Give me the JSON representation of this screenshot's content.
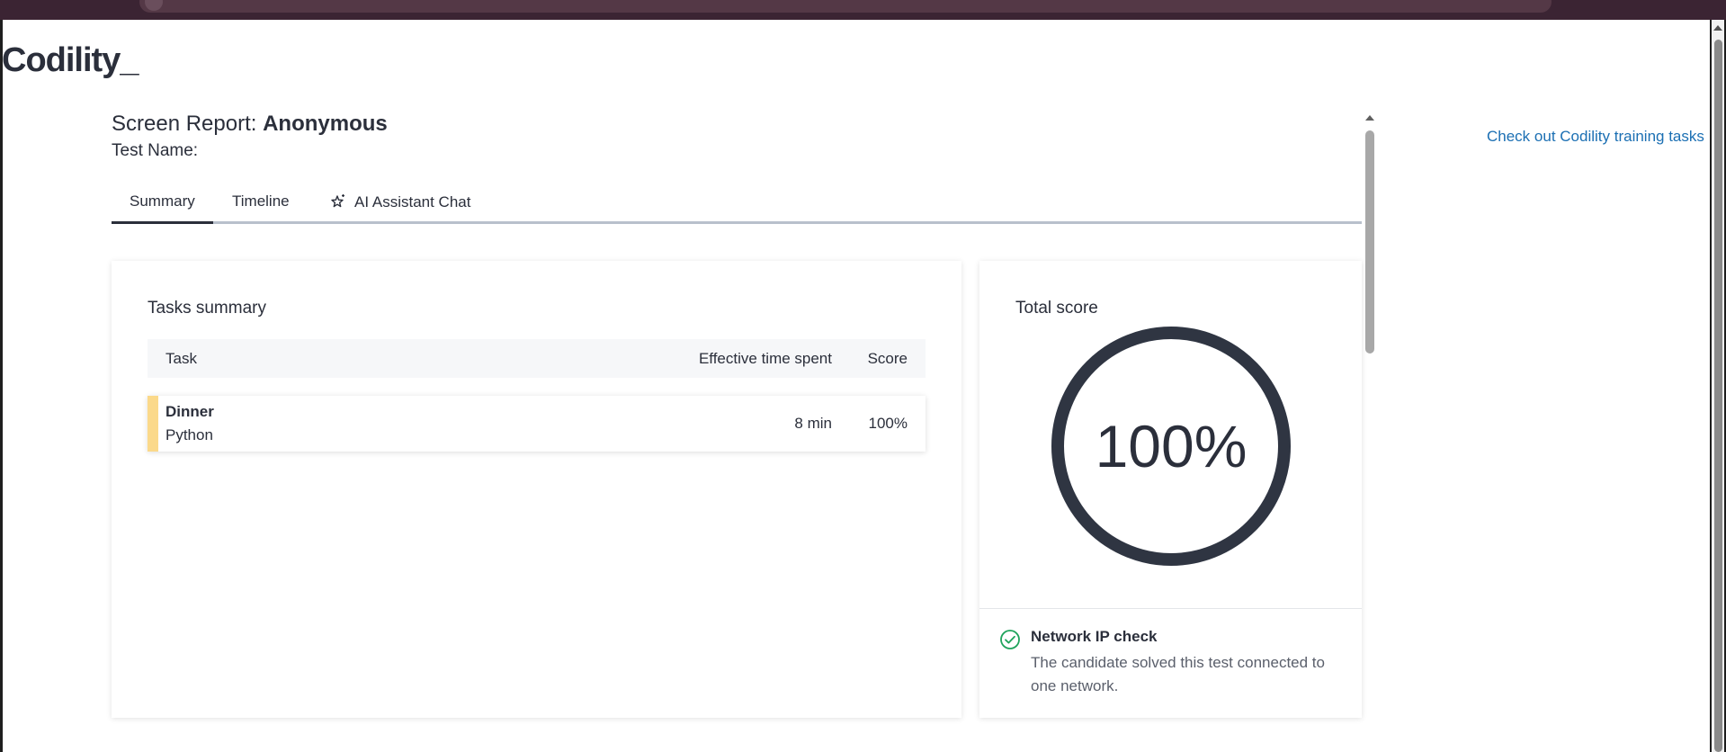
{
  "app": {
    "logo": "Codility_"
  },
  "header": {
    "title_prefix": "Screen Report:",
    "title_name": "Anonymous",
    "test_name_label": "Test Name:"
  },
  "links": {
    "training": "Check out Codility training tasks"
  },
  "tabs": [
    {
      "label": "Summary",
      "active": true
    },
    {
      "label": "Timeline",
      "active": false
    },
    {
      "label": "AI Assistant Chat",
      "active": false,
      "icon": "sparkle-star-icon"
    }
  ],
  "tasks_summary": {
    "heading": "Tasks summary",
    "columns": {
      "task": "Task",
      "time": "Effective time spent",
      "score": "Score"
    },
    "rows": [
      {
        "name": "Dinner",
        "language": "Python",
        "time": "8 min",
        "score": "100%",
        "accent_color": "#fbd98a"
      }
    ]
  },
  "total_score": {
    "heading": "Total score",
    "value": "100%",
    "fraction": 1.0,
    "ring_color": "#2f3542"
  },
  "network_check": {
    "title": "Network IP check",
    "text": "The candidate solved this test connected to one network.",
    "status_color": "#1fa35c",
    "icon": "check-circle-icon"
  }
}
